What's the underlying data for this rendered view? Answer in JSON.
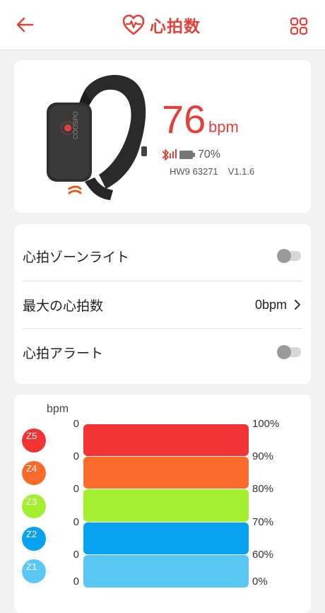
{
  "header": {
    "title": "心拍数",
    "back_icon": "back-arrow-icon",
    "menu_icon": "grid-menu-icon"
  },
  "device": {
    "heart_rate": "76",
    "unit": "bpm",
    "battery": "70%",
    "model": "HW9 63271",
    "firmware": "V1.1.6",
    "brand_colors": {
      "accent": "#e0413a"
    }
  },
  "settings": {
    "zone_light_label": "心拍ゾーンライト",
    "zone_light_on": false,
    "max_hr_label": "最大の心拍数",
    "max_hr_value": "0bpm",
    "alert_label": "心拍アラート",
    "alert_on": false
  },
  "zones": {
    "bpm_label": "bpm",
    "items": [
      {
        "id": "Z5",
        "bpm": "0",
        "percent": "100%",
        "color": "#f23434"
      },
      {
        "id": "Z4",
        "bpm": "0",
        "percent": "90%",
        "color": "#fa6a2b"
      },
      {
        "id": "Z3",
        "bpm": "0",
        "percent": "80%",
        "color": "#a4ef2f"
      },
      {
        "id": "Z2",
        "bpm": "0",
        "percent": "70%",
        "color": "#07a2ee"
      },
      {
        "id": "Z1",
        "bpm": "0",
        "percent": "60%",
        "color": "#5ac8f5"
      }
    ],
    "bottom_bpm": "0",
    "bottom_percent": "0%"
  }
}
